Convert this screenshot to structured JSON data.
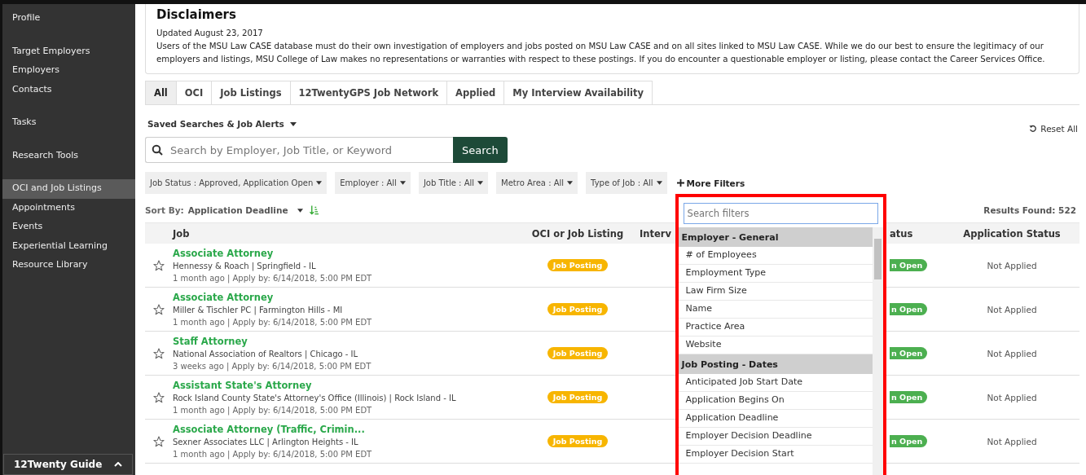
{
  "sidebar": {
    "groups": [
      [
        {
          "label": "Profile",
          "selected": false
        }
      ],
      [
        {
          "label": "Target Employers",
          "selected": false
        },
        {
          "label": "Employers",
          "selected": false
        },
        {
          "label": "Contacts",
          "selected": false
        }
      ],
      [
        {
          "label": "Tasks",
          "selected": false
        }
      ],
      [
        {
          "label": "Research Tools",
          "selected": false
        }
      ],
      [
        {
          "label": "OCI and Job Listings",
          "selected": true
        },
        {
          "label": "Appointments",
          "selected": false
        },
        {
          "label": "Events",
          "selected": false
        },
        {
          "label": "Experiential Learning",
          "selected": false
        },
        {
          "label": "Resource Library",
          "selected": false
        }
      ]
    ],
    "guide": "12Twenty Guide"
  },
  "disclaimer": {
    "title": "Disclaimers",
    "updated": "Updated August 23, 2017",
    "body": "Users of the MSU Law CASE database must do their own investigation of employers and jobs posted on MSU Law CASE and on all sites linked to MSU Law CASE. While we do our best to ensure the legitimacy of our employers and listings, MSU College of Law makes no representations or warranties with respect to these postings. If you do encounter a questionable employer or listing, please contact the Career Services Office."
  },
  "tabs": [
    {
      "label": "All",
      "selected": true
    },
    {
      "label": "OCI",
      "selected": false
    },
    {
      "label": "Job Listings",
      "selected": false
    },
    {
      "label": "12TwentyGPS Job Network",
      "selected": false
    },
    {
      "label": "Applied",
      "selected": false
    },
    {
      "label": "My Interview Availability",
      "selected": false
    }
  ],
  "saved_searches": "Saved Searches & Job Alerts",
  "reset": "Reset All",
  "search": {
    "placeholder": "Search by Employer, Job Title, or Keyword",
    "button": "Search"
  },
  "filters": [
    "Job Status : Approved, Application Open",
    "Employer : All",
    "Job Title : All",
    "Metro Area : All",
    "Type of Job : All"
  ],
  "more_filters": "More Filters",
  "sort": {
    "label": "Sort By:",
    "value": "Application Deadline"
  },
  "results": "Results Found: 522",
  "table": {
    "columns": [
      "Job",
      "OCI or Job Listing",
      "Interv",
      "atus",
      "Application Status"
    ],
    "rows": [
      {
        "title": "Associate Attorney",
        "employer": "Hennessy & Roach | Springfield - IL",
        "meta": "1 month ago | Apply by: 6/14/2018, 5:00 PM EDT",
        "listing": "Job Posting",
        "status": "n Open",
        "application_status": "Not Applied"
      },
      {
        "title": "Associate Attorney",
        "employer": "Miller & Tischler PC | Farmington Hills - MI",
        "meta": "1 month ago | Apply by: 6/14/2018, 5:00 PM EDT",
        "listing": "Job Posting",
        "status": "n Open",
        "application_status": "Not Applied"
      },
      {
        "title": "Staff Attorney",
        "employer": "National Association of Realtors | Chicago - IL",
        "meta": "3 weeks ago | Apply by: 6/14/2018, 5:00 PM EDT",
        "listing": "Job Posting",
        "status": "n Open",
        "application_status": "Not Applied"
      },
      {
        "title": "Assistant State's Attorney",
        "employer": "Rock Island County State's Attorney's Office (Illinois) | Rock Island - IL",
        "meta": "1 month ago | Apply by: 6/14/2018, 5:00 PM EDT",
        "listing": "Job Posting",
        "status": "n Open",
        "application_status": "Not Applied"
      },
      {
        "title": "Associate Attorney (Traffic, Crimin...",
        "employer": "Sexner Associates LLC | Arlington Heights - IL",
        "meta": "1 month ago | Apply by: 6/14/2018, 5:00 PM EDT",
        "listing": "Job Posting",
        "status": "n Open",
        "application_status": "Not Applied"
      }
    ]
  },
  "filter_menu": {
    "placeholder": "Search filters",
    "items": [
      {
        "kind": "group",
        "label": "Employer - General"
      },
      {
        "kind": "option",
        "label": "# of Employees"
      },
      {
        "kind": "option",
        "label": "Employment Type"
      },
      {
        "kind": "option",
        "label": "Law Firm Size"
      },
      {
        "kind": "option",
        "label": "Name"
      },
      {
        "kind": "option",
        "label": "Practice Area"
      },
      {
        "kind": "option",
        "label": "Website"
      },
      {
        "kind": "group",
        "label": "Job Posting - Dates"
      },
      {
        "kind": "option",
        "label": "Anticipated Job Start Date"
      },
      {
        "kind": "option",
        "label": "Application Begins On"
      },
      {
        "kind": "option",
        "label": "Application Deadline"
      },
      {
        "kind": "option",
        "label": "Employer Decision Deadline"
      },
      {
        "kind": "option",
        "label": "Employer Decision Start"
      }
    ]
  }
}
